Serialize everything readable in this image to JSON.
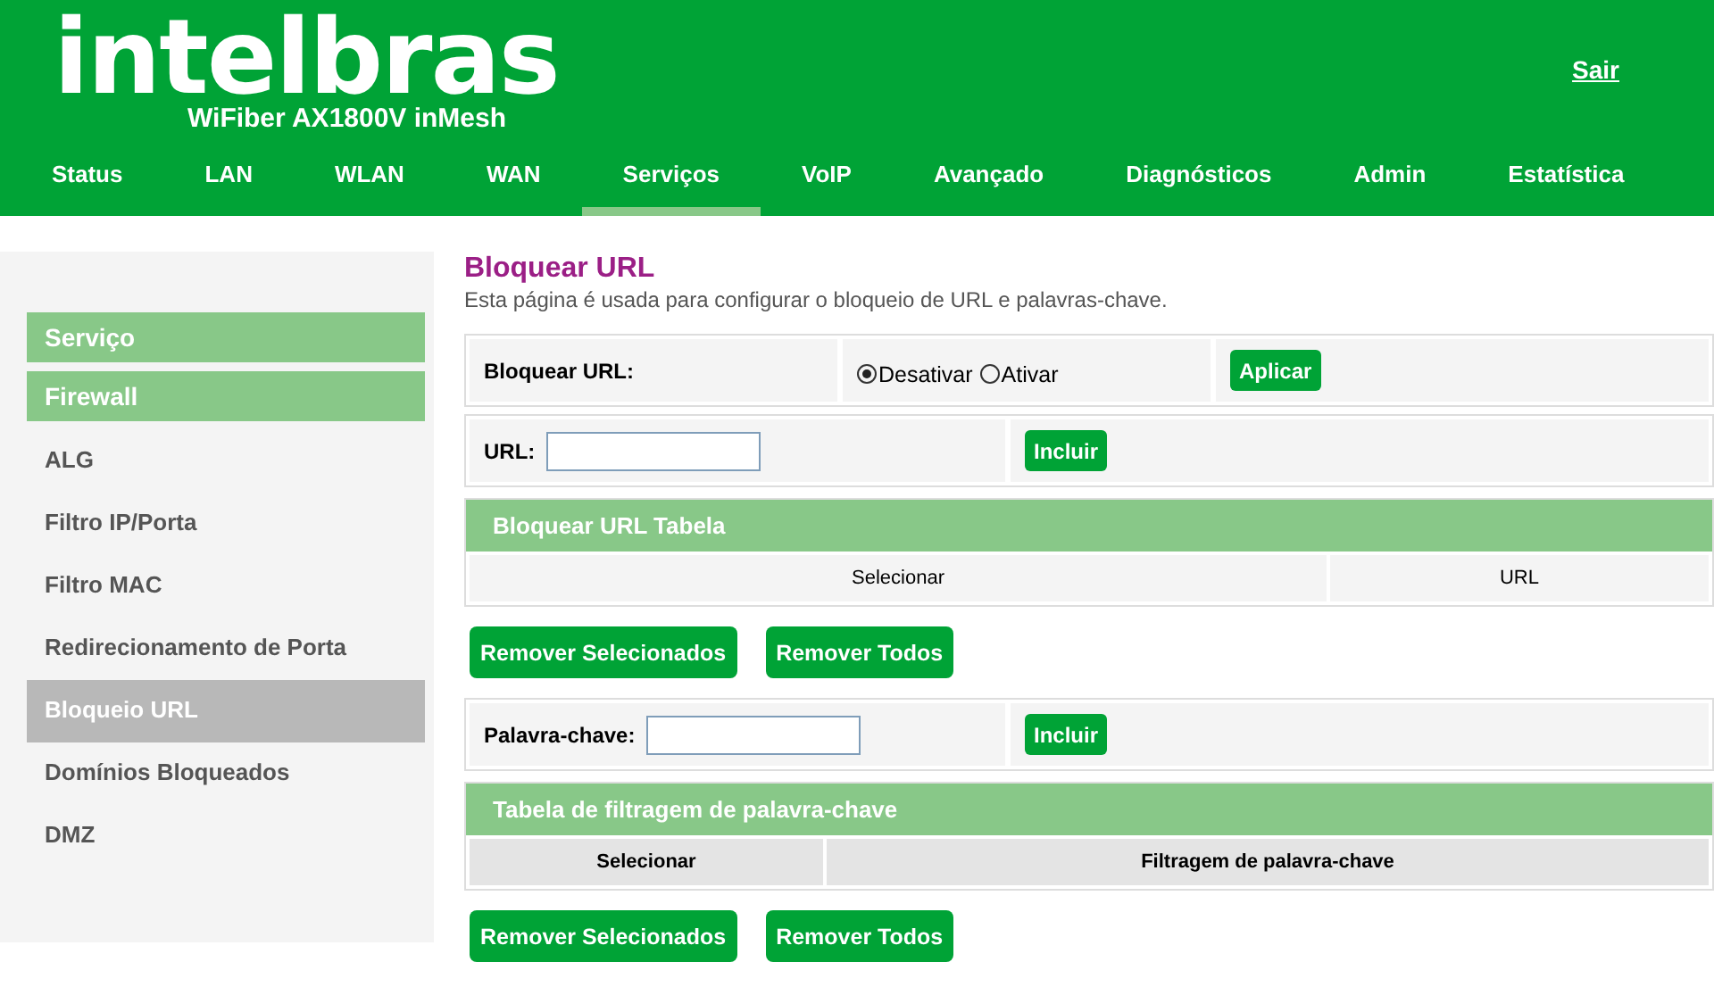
{
  "header": {
    "logo": "intelbras",
    "model": "WiFiber AX1800V inMesh",
    "logout": "Sair"
  },
  "nav": [
    {
      "label": "Status",
      "selected": false
    },
    {
      "label": "LAN",
      "selected": false
    },
    {
      "label": "WLAN",
      "selected": false
    },
    {
      "label": "WAN",
      "selected": false
    },
    {
      "label": "Serviços",
      "selected": true
    },
    {
      "label": "VoIP",
      "selected": false
    },
    {
      "label": "Avançado",
      "selected": false
    },
    {
      "label": "Diagnósticos",
      "selected": false
    },
    {
      "label": "Admin",
      "selected": false
    },
    {
      "label": "Estatística",
      "selected": false
    }
  ],
  "sidebar": [
    {
      "kind": "header",
      "label": "Serviço"
    },
    {
      "kind": "header",
      "label": "Firewall"
    },
    {
      "kind": "item",
      "label": "ALG",
      "selected": false
    },
    {
      "kind": "item",
      "label": "Filtro IP/Porta",
      "selected": false
    },
    {
      "kind": "item",
      "label": "Filtro MAC",
      "selected": false
    },
    {
      "kind": "item",
      "label": "Redirecionamento de Porta",
      "selected": false
    },
    {
      "kind": "item",
      "label": "Bloqueio URL",
      "selected": true
    },
    {
      "kind": "item",
      "label": "Domínios Bloqueados",
      "selected": false
    },
    {
      "kind": "item",
      "label": "DMZ",
      "selected": false
    }
  ],
  "page": {
    "title": "Bloquear URL",
    "description": "Esta página é usada para configurar o bloqueio de URL e palavras-chave."
  },
  "block_url": {
    "label": "Bloquear URL:",
    "options": [
      {
        "label": "Desativar",
        "selected": true
      },
      {
        "label": "Ativar",
        "selected": false
      }
    ],
    "button": "Aplicar"
  },
  "url_form": {
    "label": "URL:",
    "button": "Incluir"
  },
  "url_table": {
    "title": "Bloquear URL Tabela",
    "columns": [
      "Selecionar",
      "URL"
    ],
    "buttons": [
      "Remover Selecionados",
      "Remover Todos"
    ]
  },
  "keyword_form": {
    "label": "Palavra-chave:",
    "button": "Incluir"
  },
  "keyword_table": {
    "title": "Tabela de filtragem de palavra-chave",
    "columns": [
      "Selecionar",
      "Filtragem de palavra-chave"
    ],
    "buttons": [
      "Remover Selecionados",
      "Remover Todos"
    ]
  }
}
